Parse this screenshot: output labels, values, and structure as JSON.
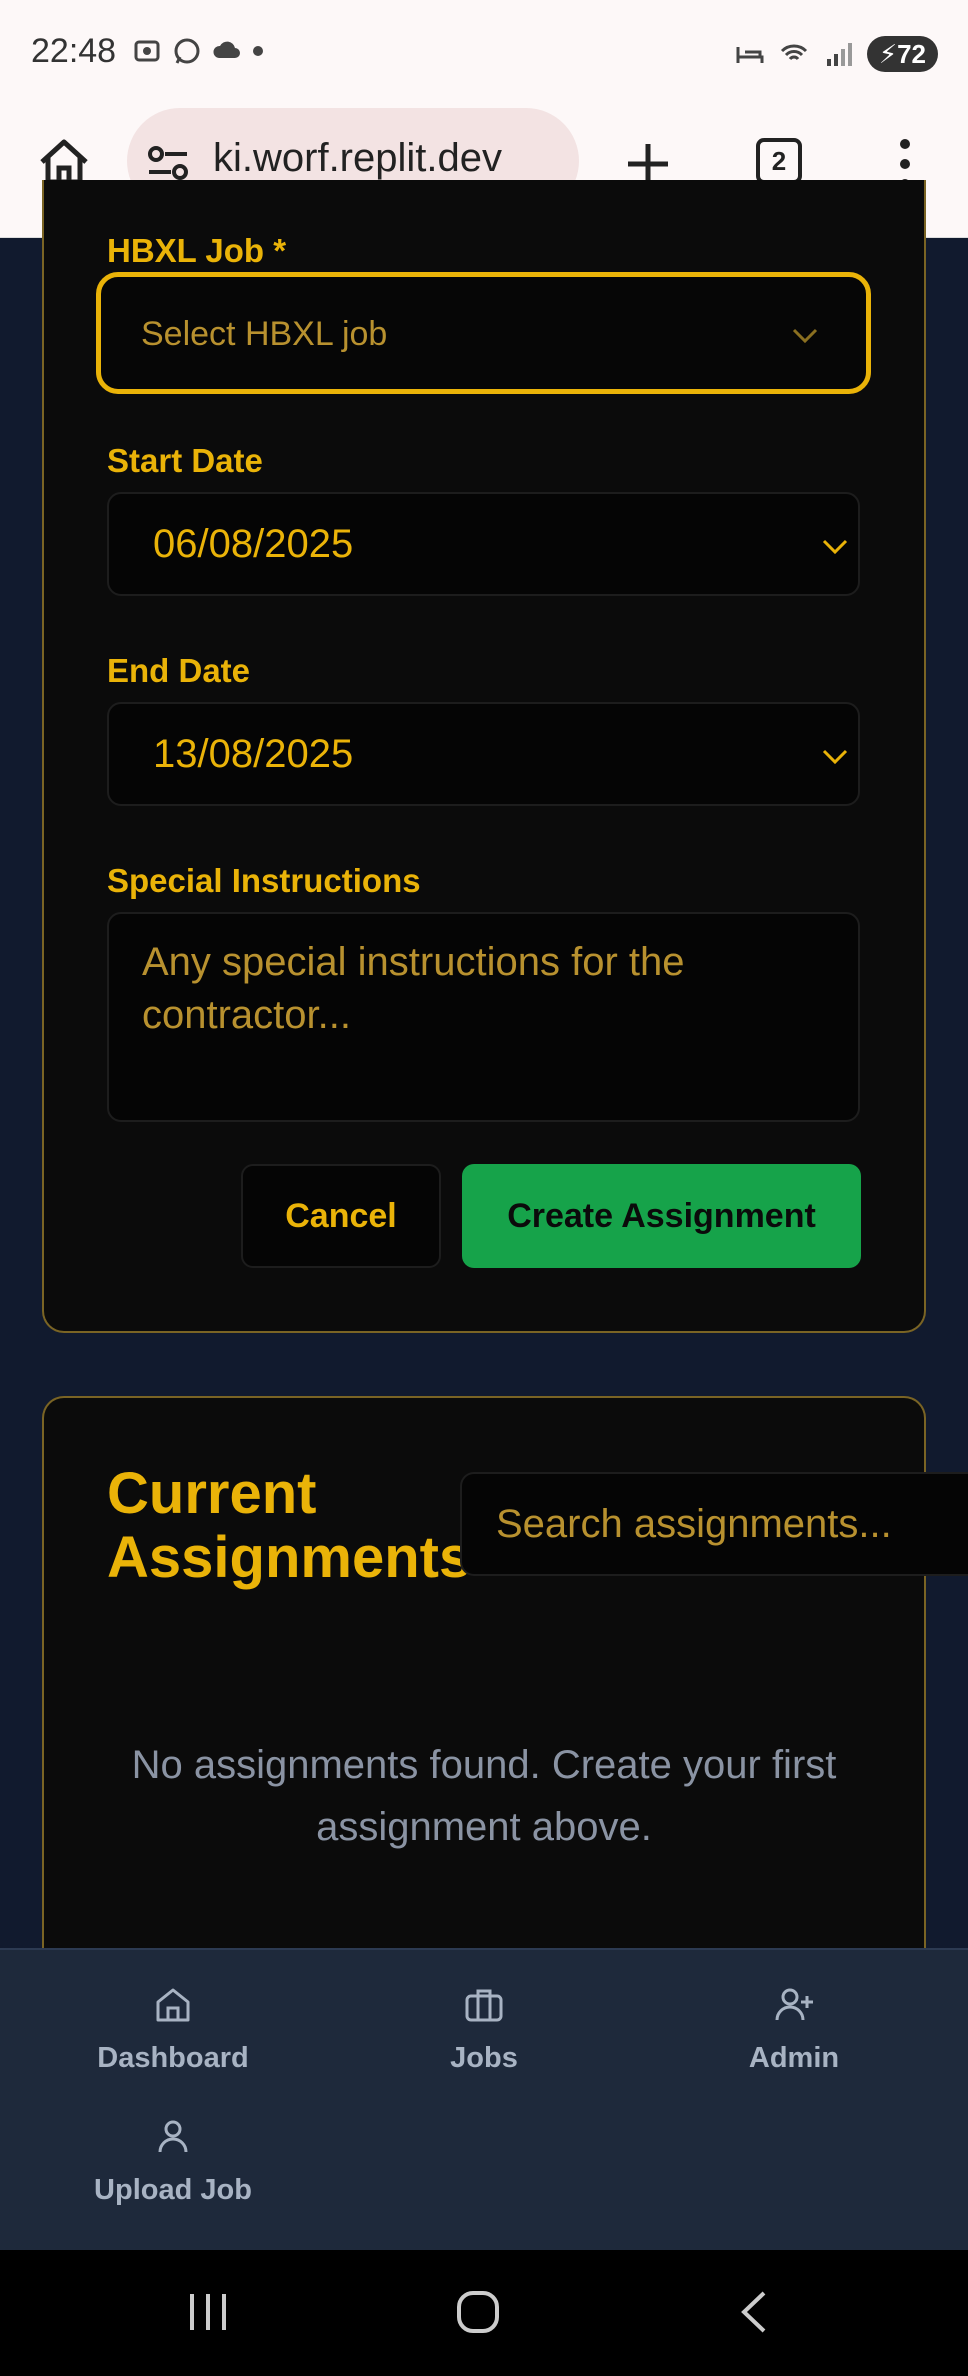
{
  "status_bar": {
    "time": "22:48",
    "battery": "72",
    "icons_left": [
      "screenshot-icon",
      "whatsapp-icon",
      "cloud-icon",
      "dot-icon"
    ],
    "icons_right": [
      "bed-icon",
      "wifi-icon",
      "signal-icon",
      "battery-icon"
    ]
  },
  "browser": {
    "url": "ki.worf.replit.dev",
    "tab_count": "2"
  },
  "form": {
    "hbxl_job_label": "HBXL Job *",
    "hbxl_job_placeholder": "Select HBXL job",
    "start_date_label": "Start Date",
    "start_date_value": "06/08/2025",
    "end_date_label": "End Date",
    "end_date_value": "13/08/2025",
    "instructions_label": "Special Instructions",
    "instructions_placeholder": "Any special instructions for the contractor...",
    "cancel_label": "Cancel",
    "create_label": "Create Assignment"
  },
  "assignments": {
    "title": "Current Assignments",
    "search_placeholder": "Search assignments...",
    "empty_message": "No assignments found. Create your first assignment above."
  },
  "bottom_nav": {
    "dashboard": "Dashboard",
    "jobs": "Jobs",
    "admin": "Admin",
    "upload_job": "Upload Job"
  },
  "colors": {
    "accent": "#eab308",
    "create_button": "#16a34a",
    "page_background": "#111a2e",
    "card_background": "#0b0b0b",
    "nav_background": "#1e293b"
  }
}
